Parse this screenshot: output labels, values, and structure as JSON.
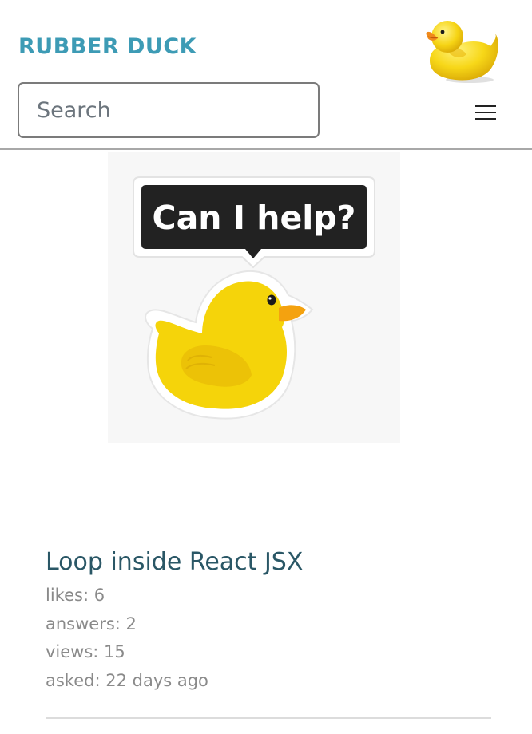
{
  "header": {
    "brand": "RUBBER DUCK",
    "logo_icon": "rubber-duck-icon",
    "menu_icon": "hamburger-menu-icon"
  },
  "search": {
    "placeholder": "Search",
    "value": ""
  },
  "hero": {
    "speech_bubble": "Can I help?",
    "icon": "rubber-duck-sticker-icon"
  },
  "questions": [
    {
      "title": "Loop inside React JSX",
      "likes": "likes: 6",
      "answers": "answers: 2",
      "views": "views: 15",
      "asked": "asked: 22 days ago"
    }
  ],
  "colors": {
    "brand": "#3d9bb5",
    "title": "#2a5766",
    "muted": "#8a8a8a",
    "duck_yellow": "#f5d40a",
    "beak_orange": "#f4a20f"
  }
}
